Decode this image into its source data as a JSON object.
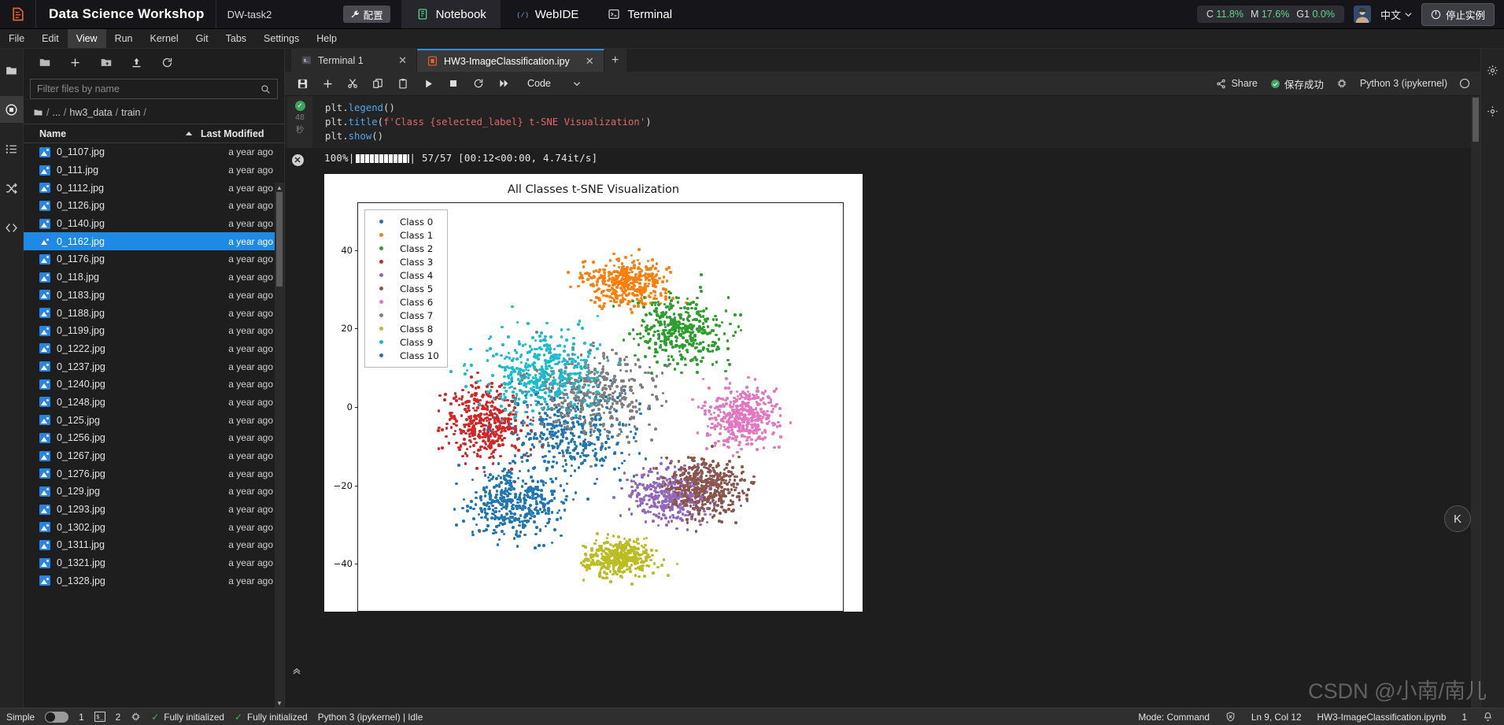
{
  "topbar": {
    "logo_icon": "app-logo-icon",
    "app_title": "Data Science Workshop",
    "task_name": "DW-task2",
    "config_button": "配置",
    "config_icon": "wrench-icon",
    "tabs": [
      {
        "label": "Notebook",
        "icon": "notebook-icon",
        "active": true
      },
      {
        "label": "WebIDE",
        "icon": "code-icon",
        "active": false
      },
      {
        "label": "Terminal",
        "icon": "terminal-icon",
        "active": false
      }
    ],
    "resources": [
      {
        "key": "C",
        "value": "11.8%"
      },
      {
        "key": "M",
        "value": "17.6%"
      },
      {
        "key": "G1",
        "value": "0.0%"
      }
    ],
    "avatar_icon": "user-avatar",
    "language": "中文",
    "language_caret": "chevron-down-icon",
    "stop_button": "停止实例",
    "stop_icon": "power-icon"
  },
  "menubar": {
    "items": [
      "File",
      "Edit",
      "View",
      "Run",
      "Kernel",
      "Git",
      "Tabs",
      "Settings",
      "Help"
    ],
    "active": "View"
  },
  "left_rail": {
    "items": [
      {
        "name": "folder-icon",
        "active": false
      },
      {
        "name": "running-terminals-icon",
        "active": true
      },
      {
        "name": "commands-list-icon",
        "active": false
      },
      {
        "name": "git-shuffle-icon",
        "active": false
      },
      {
        "name": "extensions-code-icon",
        "active": false
      }
    ]
  },
  "filebrowser": {
    "toolbar_icons": [
      "folder-icon",
      "new-launcher-icon",
      "new-folder-icon",
      "upload-icon",
      "refresh-icon"
    ],
    "filter_placeholder": "Filter files by name",
    "filter_value": "",
    "search_icon": "search-icon",
    "breadcrumb": [
      "/",
      "...",
      "/",
      "hw3_data",
      "/",
      "train",
      "/"
    ],
    "breadcrumb_root_icon": "folder-icon",
    "columns": {
      "name": "Name",
      "modified": "Last Modified",
      "sort_icon": "sort-asc-icon"
    },
    "rows": [
      {
        "name": "0_1107.jpg",
        "modified": "a year ago",
        "selected": false
      },
      {
        "name": "0_111.jpg",
        "modified": "a year ago",
        "selected": false
      },
      {
        "name": "0_1112.jpg",
        "modified": "a year ago",
        "selected": false
      },
      {
        "name": "0_1126.jpg",
        "modified": "a year ago",
        "selected": false
      },
      {
        "name": "0_1140.jpg",
        "modified": "a year ago",
        "selected": false
      },
      {
        "name": "0_1162.jpg",
        "modified": "a year ago",
        "selected": true
      },
      {
        "name": "0_1176.jpg",
        "modified": "a year ago",
        "selected": false
      },
      {
        "name": "0_118.jpg",
        "modified": "a year ago",
        "selected": false
      },
      {
        "name": "0_1183.jpg",
        "modified": "a year ago",
        "selected": false
      },
      {
        "name": "0_1188.jpg",
        "modified": "a year ago",
        "selected": false
      },
      {
        "name": "0_1199.jpg",
        "modified": "a year ago",
        "selected": false
      },
      {
        "name": "0_1222.jpg",
        "modified": "a year ago",
        "selected": false
      },
      {
        "name": "0_1237.jpg",
        "modified": "a year ago",
        "selected": false
      },
      {
        "name": "0_1240.jpg",
        "modified": "a year ago",
        "selected": false
      },
      {
        "name": "0_1248.jpg",
        "modified": "a year ago",
        "selected": false
      },
      {
        "name": "0_125.jpg",
        "modified": "a year ago",
        "selected": false
      },
      {
        "name": "0_1256.jpg",
        "modified": "a year ago",
        "selected": false
      },
      {
        "name": "0_1267.jpg",
        "modified": "a year ago",
        "selected": false
      },
      {
        "name": "0_1276.jpg",
        "modified": "a year ago",
        "selected": false
      },
      {
        "name": "0_129.jpg",
        "modified": "a year ago",
        "selected": false
      },
      {
        "name": "0_1293.jpg",
        "modified": "a year ago",
        "selected": false
      },
      {
        "name": "0_1302.jpg",
        "modified": "a year ago",
        "selected": false
      },
      {
        "name": "0_1311.jpg",
        "modified": "a year ago",
        "selected": false
      },
      {
        "name": "0_1321.jpg",
        "modified": "a year ago",
        "selected": false
      },
      {
        "name": "0_1328.jpg",
        "modified": "a year ago",
        "selected": false
      }
    ]
  },
  "doc_tabs": {
    "tabs": [
      {
        "label": "Terminal 1",
        "icon": "terminal-icon",
        "active": false,
        "close_icon": "close-icon"
      },
      {
        "label": "HW3-ImageClassification.ipy",
        "icon": "notebook-icon",
        "active": true,
        "close_icon": "close-icon"
      }
    ],
    "add_icon": "add-tab-icon"
  },
  "notebook_toolbar": {
    "icons": [
      "save-icon",
      "insert-cell-icon",
      "cut-icon",
      "copy-icon",
      "paste-icon",
      "run-icon",
      "stop-icon",
      "restart-icon",
      "restart-run-all-icon"
    ],
    "cell_type": "Code",
    "cell_type_caret": "chevron-down-icon",
    "share_label": "Share",
    "share_icon": "share-icon",
    "save_status": "保存成功",
    "save_status_icon": "check-circle-icon",
    "kernel_switch_icon": "kernel-switch-icon",
    "kernel_name": "Python 3 (ipykernel)",
    "kernel_idle_icon": "kernel-idle-circle"
  },
  "cell": {
    "status_icon": "success-check-icon",
    "exec_time": "48",
    "exec_time_unit": "秒",
    "code_lines": [
      [
        {
          "t": "plt.",
          "c": "plain"
        },
        {
          "t": "legend",
          "c": "fn"
        },
        {
          "t": "()",
          "c": "plain"
        }
      ],
      [
        {
          "t": "plt.",
          "c": "plain"
        },
        {
          "t": "title",
          "c": "fn"
        },
        {
          "t": "(",
          "c": "plain"
        },
        {
          "t": "f'Class {selected_label} ",
          "c": "str"
        },
        {
          "t": "t-SNE Visualization'",
          "c": "str"
        },
        {
          "t": ")",
          "c": "plain"
        }
      ],
      [
        {
          "t": "plt.",
          "c": "plain"
        },
        {
          "t": "show",
          "c": "fn"
        },
        {
          "t": "()",
          "c": "plain"
        }
      ]
    ],
    "output_icon": "stop-output-icon",
    "progress_percent": "100%",
    "progress_prefix": "100%|",
    "progress_suffix": "| 57/57 [00:12<00:00,  4.74it/s]",
    "progress_value": 100,
    "progress_count": "57/57",
    "progress_elapsed": "00:12",
    "progress_remaining": "00:00",
    "progress_rate": "4.74it/s"
  },
  "chart_data": {
    "type": "scatter",
    "title": "All Classes t-SNE Visualization",
    "xlabel": "",
    "ylabel": "",
    "grid": false,
    "legend_position": "upper left",
    "xlim": [
      -55,
      55
    ],
    "ylim": [
      -52,
      52
    ],
    "yticks": [
      40,
      20,
      0,
      -20,
      -40
    ],
    "ytick_labels": [
      "40",
      "20",
      "0",
      "−20",
      "−40"
    ],
    "xticks": [],
    "series": [
      {
        "name": "Class 0",
        "color": "#1f77b4",
        "n": 400,
        "cx": -8,
        "cy": -6,
        "sx": 26,
        "sy": 20
      },
      {
        "name": "Class 1",
        "color": "#ff7f0e",
        "n": 400,
        "cx": 6,
        "cy": 32,
        "sx": 17,
        "sy": 10
      },
      {
        "name": "Class 2",
        "color": "#2ca02c",
        "n": 400,
        "cx": 18,
        "cy": 20,
        "sx": 18,
        "sy": 14
      },
      {
        "name": "Class 3",
        "color": "#d62728",
        "n": 400,
        "cx": -26,
        "cy": -4,
        "sx": 14,
        "sy": 16
      },
      {
        "name": "Class 4",
        "color": "#9467bd",
        "n": 400,
        "cx": 16,
        "cy": -22,
        "sx": 16,
        "sy": 12
      },
      {
        "name": "Class 5",
        "color": "#8c564b",
        "n": 400,
        "cx": 24,
        "cy": -20,
        "sx": 15,
        "sy": 13
      },
      {
        "name": "Class 6",
        "color": "#e377c2",
        "n": 400,
        "cx": 32,
        "cy": -2,
        "sx": 13,
        "sy": 13
      },
      {
        "name": "Class 7",
        "color": "#7f7f7f",
        "n": 400,
        "cx": -2,
        "cy": 4,
        "sx": 24,
        "sy": 20
      },
      {
        "name": "Class 8",
        "color": "#bcbd22",
        "n": 400,
        "cx": 4,
        "cy": -38,
        "sx": 13,
        "sy": 8
      },
      {
        "name": "Class 9",
        "color": "#17becf",
        "n": 400,
        "cx": -14,
        "cy": 10,
        "sx": 22,
        "sy": 18
      },
      {
        "name": "Class 10",
        "color": "#1f77b4",
        "n": 400,
        "cx": -20,
        "cy": -24,
        "sx": 18,
        "sy": 14
      }
    ]
  },
  "right_rail": {
    "items": [
      {
        "name": "settings-gear-icon"
      },
      {
        "name": "property-inspector-icon"
      }
    ]
  },
  "statusbar": {
    "simple_label": "Simple",
    "simple_toggle_on": false,
    "kernel_count": "1",
    "terminal_icon": "terminal-small-icon",
    "terminal_count": "2",
    "cpu_icon": "cpu-icon",
    "init_status_1": "Fully initialized",
    "init_status_2": "Fully initialized",
    "kernel_status": "Python 3 (ipykernel) | Idle",
    "mode": "Mode: Command",
    "no_connection_icon": "shield-off-icon",
    "cursor_position": "Ln 9, Col 12",
    "notebook_name": "HW3-ImageClassification.ipynb",
    "notification_count": "1",
    "bell_icon": "bell-icon"
  },
  "watermark": "CSDN @小南/南儿"
}
